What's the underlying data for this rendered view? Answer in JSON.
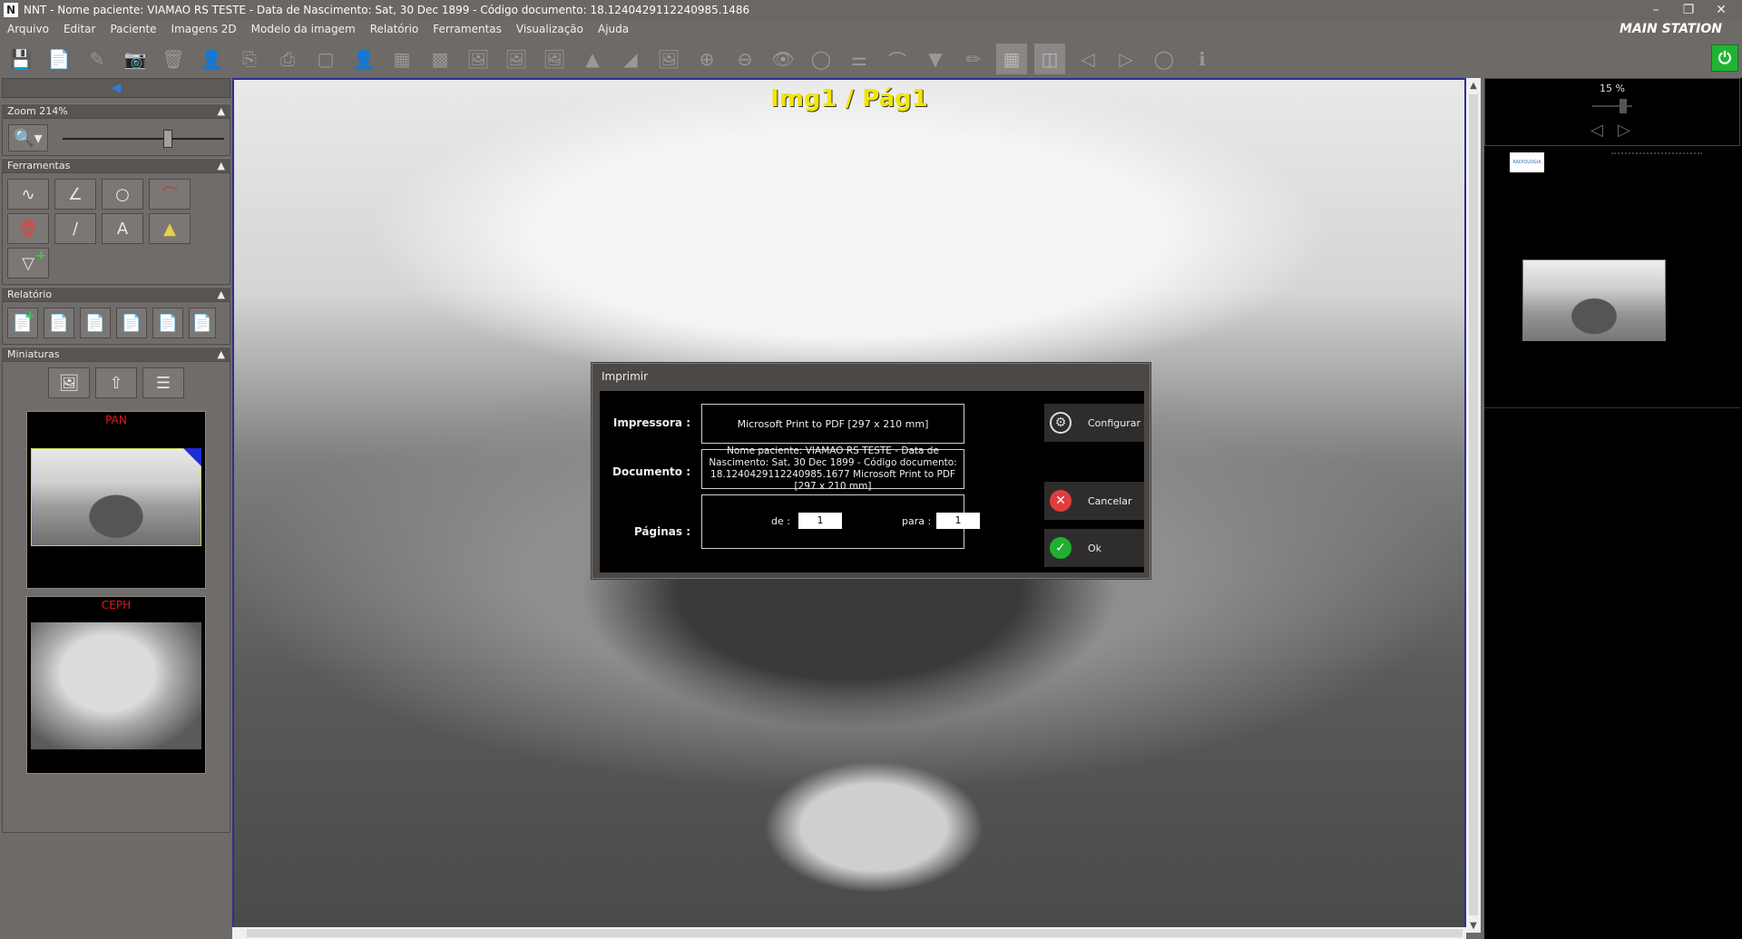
{
  "window": {
    "title": "NNT - Nome paciente: VIAMAO RS TESTE - Data de Nascimento: Sat, 30 Dec 1899 - Código documento: 18.1240429112240985.1486",
    "logo_letter": "N",
    "station": "MAIN STATION"
  },
  "menu": [
    "Arquivo",
    "Editar",
    "Paciente",
    "Imagens 2D",
    "Modelo da imagem",
    "Relatório",
    "Ferramentas",
    "Visualização",
    "Ajuda"
  ],
  "left_panel": {
    "zoom_header": "Zoom 214%",
    "zoom_level": 0.65,
    "tools_header": "Ferramentas",
    "report_header": "Relatório",
    "thumbs_header": "Miniaturas",
    "thumbnails": [
      {
        "label": "PAN"
      },
      {
        "label": "CEPH"
      }
    ]
  },
  "viewer": {
    "title": "Img1 / Pág1"
  },
  "right_panel": {
    "zoom_percent": "15 %",
    "logo_text": "RADIOLOGIA"
  },
  "dialog": {
    "title": "Imprimir",
    "printer_label": "Impressora :",
    "printer_value": "Microsoft Print to PDF [297 x 210 mm]",
    "document_label": "Documento :",
    "document_value": "Nome paciente: VIAMAO RS TESTE - Data de Nascimento: Sat, 30 Dec 1899 - Código documento: 18.1240429112240985.1677 Microsoft Print to PDF [297 x 210 mm]",
    "pages_label": "Páginas :",
    "from_label": "de :",
    "from_value": "1",
    "to_label": "para :",
    "to_value": "1",
    "configure_button": "Configurar",
    "cancel_button": "Cancelar",
    "ok_button": "Ok"
  },
  "colors": {
    "accent_yellow": "#f2e600",
    "thumb_label_red": "#e21b1b",
    "power_green": "#1fb532",
    "viewer_border": "#2b2f9c"
  }
}
